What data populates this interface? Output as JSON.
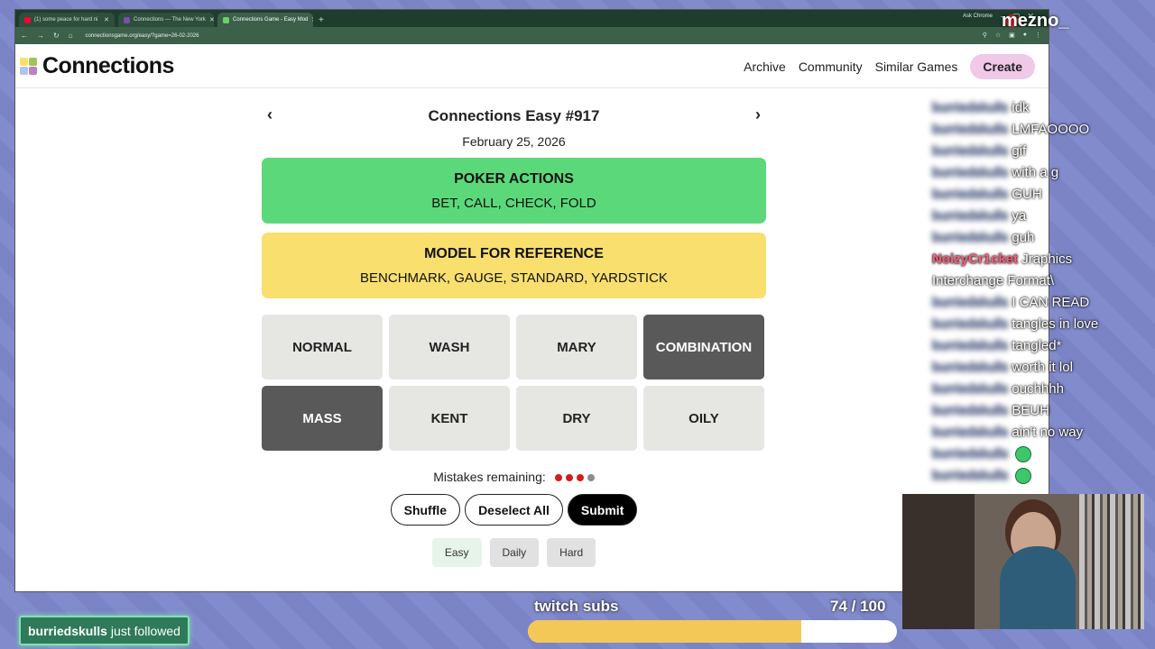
{
  "browser": {
    "tabs": [
      {
        "title": "(1) some peace for hard ni",
        "favicon_color": "#ff0033"
      },
      {
        "title": "Connections — The New York",
        "favicon_color": "#7a4db3"
      },
      {
        "title": "Connections Game - Easy Mod",
        "favicon_color": "#6ecf6e"
      }
    ],
    "ask_chrome": "Ask Chrome",
    "url": "connectionsgame.org/easy/?game=26-02-2026"
  },
  "site": {
    "logo_text": "Connections",
    "nav": [
      "Archive",
      "Community",
      "Similar Games"
    ],
    "create_label": "Create"
  },
  "game": {
    "title": "Connections Easy #917",
    "date": "February 25, 2026",
    "solved": [
      {
        "category": "POKER ACTIONS",
        "words": "BET, CALL, CHECK, FOLD",
        "color": "#5bd97a"
      },
      {
        "category": "MODEL FOR REFERENCE",
        "words": "BENCHMARK, GAUGE, STANDARD, YARDSTICK",
        "color": "#f9df6d"
      }
    ],
    "tiles": [
      {
        "word": "NORMAL",
        "selected": false
      },
      {
        "word": "WASH",
        "selected": false
      },
      {
        "word": "MARY",
        "selected": false
      },
      {
        "word": "COMBINATION",
        "selected": true
      },
      {
        "word": "MASS",
        "selected": true
      },
      {
        "word": "KENT",
        "selected": false
      },
      {
        "word": "DRY",
        "selected": false
      },
      {
        "word": "OILY",
        "selected": false
      }
    ],
    "mistakes_label": "Mistakes remaining:",
    "mistakes_dots": [
      "#d31d1d",
      "#d31d1d",
      "#d31d1d",
      "#8c8c8c"
    ],
    "shuffle_label": "Shuffle",
    "deselect_label": "Deselect All",
    "submit_label": "Submit",
    "modes": [
      {
        "label": "Easy",
        "active": true
      },
      {
        "label": "Daily",
        "active": false
      },
      {
        "label": "Hard",
        "active": false
      }
    ]
  },
  "stream": {
    "streamer_name": "mezno_",
    "chat": [
      {
        "user": "burriedskulls",
        "msg": "idk"
      },
      {
        "user": "burriedskulls",
        "msg": "LMFAOOOO"
      },
      {
        "user": "burriedskulls",
        "msg": "gif"
      },
      {
        "user": "burriedskulls",
        "msg": "with a g"
      },
      {
        "user": "burriedskulls",
        "msg": "GUH"
      },
      {
        "user": "burriedskulls",
        "msg": "ya"
      },
      {
        "user": "burriedskulls",
        "msg": "guh"
      },
      {
        "user": "NoizyCr1cket",
        "msg": "Jraphics"
      },
      {
        "user": "",
        "msg": "Interchange Format\\"
      },
      {
        "user": "burriedskulls",
        "msg": "I CAN READ"
      },
      {
        "user": "burriedskulls",
        "msg": "tangles in love"
      },
      {
        "user": "burriedskulls",
        "msg": "tangled*"
      },
      {
        "user": "burriedskulls",
        "msg": "worth it lol"
      },
      {
        "user": "burriedskulls",
        "msg": "ouchhhh"
      },
      {
        "user": "burriedskulls",
        "msg": "BEUH"
      },
      {
        "user": "burriedskulls",
        "msg": "ain't no way"
      },
      {
        "user": "burriedskulls",
        "msg": "",
        "emote": true
      },
      {
        "user": "burriedskulls",
        "msg": "",
        "emote": true
      }
    ],
    "subs_label": "twitch subs",
    "subs_count": "74 / 100",
    "subs_progress": 0.74,
    "follow_user": "burriedskulls",
    "follow_text": "just followed"
  }
}
